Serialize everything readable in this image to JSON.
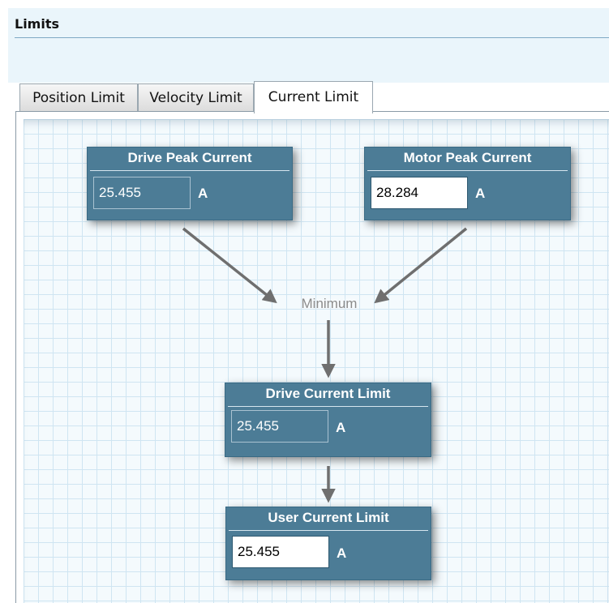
{
  "header": {
    "title": "Limits"
  },
  "tabs": [
    {
      "label": "Position Limit",
      "active": false
    },
    {
      "label": "Velocity Limit",
      "active": false
    },
    {
      "label": "Current Limit",
      "active": true
    }
  ],
  "diagram": {
    "drive_peak": {
      "title": "Drive Peak Current",
      "value": "25.455",
      "unit": "A"
    },
    "motor_peak": {
      "title": "Motor Peak Current",
      "value": "28.284",
      "unit": "A"
    },
    "combiner": {
      "label": "Minimum"
    },
    "drive_current_limit": {
      "title": "Drive Current Limit",
      "value": "25.455",
      "unit": "A"
    },
    "user_current_limit": {
      "title": "User Current Limit",
      "value": "25.455",
      "unit": "A"
    }
  },
  "colors": {
    "node_fill": "#4c7c96",
    "grid_line": "#cfe5f2",
    "arrow": "#6f6f6f"
  }
}
